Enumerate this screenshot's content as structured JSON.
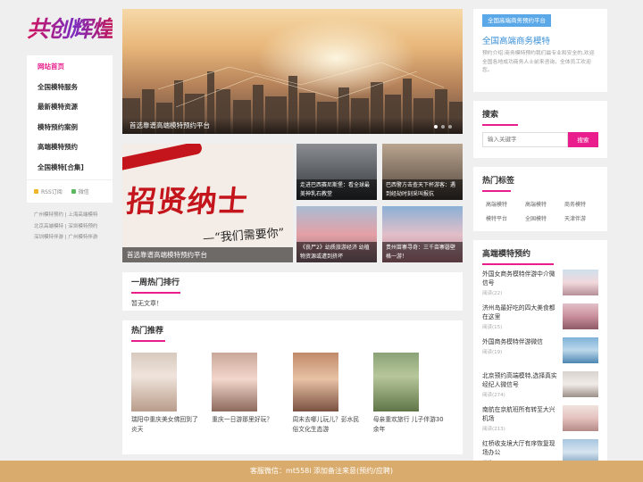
{
  "logo": {
    "text": "共创辉煌"
  },
  "nav": {
    "items": [
      "网站首页",
      "全国模特服务",
      "最新模特资源",
      "模特预约案例",
      "高端模特预约",
      "全国模特[合集]"
    ]
  },
  "sidebar": {
    "rss": "RSS订阅",
    "wechat": "微信",
    "links": [
      [
        "广州模特预约",
        "上海高端模特"
      ],
      [
        "北京高端模特",
        "深圳模特预约"
      ],
      [
        "深圳模特伴游",
        "广州模特伴游"
      ]
    ]
  },
  "banner": {
    "caption": "首选靠谱高端模特预约平台"
  },
  "grid": {
    "big": {
      "slogan": "招贤纳士",
      "sub": "—“我们需要你”",
      "caption": "首选靠谱高端模特预约平台"
    },
    "smalls": [
      "走进巴西赛尼斯堡：看全球最美神乳石教堂",
      "巴西警方击查天下杯游客：遇到经劫时刻采叫报抗",
      "《丧尸2》幼质旅游经济 幼植物资源或遭到挤坏",
      "贵州苗寨寻奇：三千亩寨磬壁格一游！"
    ]
  },
  "weekly": {
    "title": "一周热门排行",
    "empty": "暂无文章！"
  },
  "hot": {
    "title": "热门推荐",
    "items": [
      "瑞阳中重庆美女佛回到了炎天",
      "重庆一日游那里好玩？",
      "周末去哪儿玩儿？彭水民俗文化生态游",
      "母亲重欢旅行 儿子伴游30余年"
    ]
  },
  "about": {
    "tag": "全国高端商务预约平台",
    "title": "全国高端商务模特",
    "desc": "预约介绍:商务模特预约我们最专业和安全的,欢迎全国各地成功商务人士前来咨询，全体员工欢迎您。"
  },
  "search": {
    "title": "搜索",
    "placeholder": "输入关键字",
    "button": "搜索"
  },
  "tags": {
    "title": "热门标签",
    "items": [
      "高端模特",
      "高端模特",
      "商务模特",
      "模特平台",
      "全国模特",
      "天津伴游"
    ]
  },
  "hotlist": {
    "title": "高端模特预约",
    "items": [
      {
        "title": "外国女商务模特伴游中介微信号",
        "reads": "阅读(22)"
      },
      {
        "title": "济州岛最好吃的四大美食都在这里",
        "reads": "阅读(15)"
      },
      {
        "title": "外国商务模特伴游微信",
        "reads": "阅读(19)"
      },
      {
        "title": "北京预约高端模特,选择真实经纪人微信号",
        "reads": "阅读(274)"
      },
      {
        "title": "南航在京航班所有转至大兴机场",
        "reads": "阅读(213)"
      },
      {
        "title": "红桥收支境大厅有序恢复现场办公",
        "reads": "阅读(208)"
      }
    ]
  },
  "footer": {
    "text": "客服微信：mt558i 添加备注来意(预约/应聘)"
  },
  "colors": {
    "accent": "#e91e8c",
    "blue": "#5aa8e8",
    "footer": "#d9ab6c"
  }
}
